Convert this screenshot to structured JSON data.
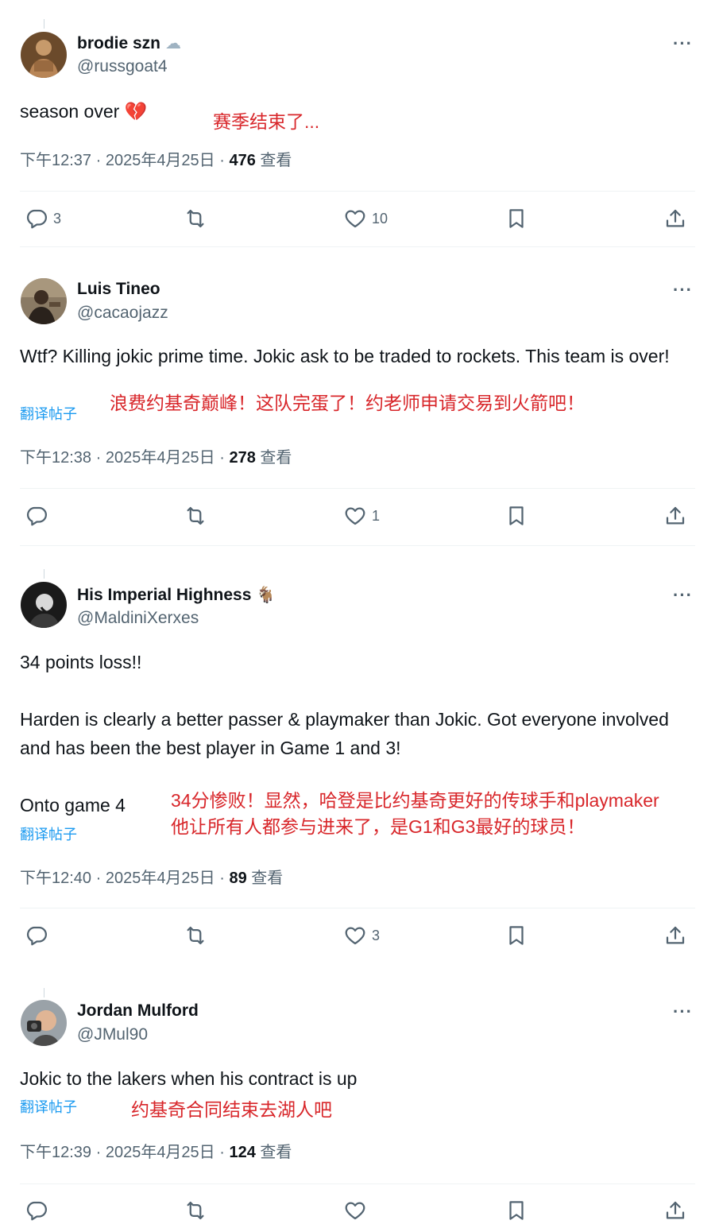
{
  "posts": [
    {
      "display_name": "brodie szn",
      "badge": "☁",
      "handle": "@russgoat4",
      "body": "season over",
      "body_emoji": "💔",
      "translate_label": "",
      "annotation": "赛季结束了...",
      "time": "下午12:37 · 2025年4月25日 · ",
      "views": "476",
      "views_suffix": " 查看",
      "reply_count": "3",
      "retweet_count": "",
      "like_count": "10",
      "more": "···"
    },
    {
      "display_name": "Luis Tineo",
      "handle": "@cacaojazz",
      "body": "Wtf? Killing jokic prime time. Jokic ask to be traded to rockets. This team is over!",
      "translate_label": "翻译帖子",
      "annotation": "浪费约基奇巅峰！这队完蛋了！约老师申请交易到火箭吧！",
      "time": "下午12:38 · 2025年4月25日 · ",
      "views": "278",
      "views_suffix": " 查看",
      "reply_count": "",
      "retweet_count": "",
      "like_count": "1",
      "more": "···"
    },
    {
      "display_name": "His Imperial Highness",
      "badge": "🐐",
      "handle": "@MaldiniXerxes",
      "body_line1": "34 points loss!!",
      "body_line2": "Harden is clearly a better passer & playmaker than Jokic. Got everyone involved and has been the best player in Game 1 and 3!",
      "body_line3": "Onto game 4",
      "translate_label": "翻译帖子",
      "annotation_line1": "34分惨败！显然，哈登是比约基奇更好的传球手和playmaker",
      "annotation_line2": "他让所有人都参与进来了，是G1和G3最好的球员！",
      "time": "下午12:40 · 2025年4月25日 · ",
      "views": "89",
      "views_suffix": " 查看",
      "reply_count": "",
      "retweet_count": "",
      "like_count": "3",
      "more": "···"
    },
    {
      "display_name": "Jordan Mulford",
      "handle": "@JMul90",
      "body": "Jokic to the lakers when his contract is up",
      "translate_label": "翻译帖子",
      "annotation": "约基奇合同结束去湖人吧",
      "time": "下午12:39 · 2025年4月25日 · ",
      "views": "124",
      "views_suffix": " 查看",
      "reply_count": "",
      "retweet_count": "",
      "like_count": "",
      "more": "···"
    }
  ],
  "icons": {
    "reply": "reply-icon",
    "retweet": "retweet-icon",
    "like": "heart-icon",
    "bookmark": "bookmark-icon",
    "share": "share-icon",
    "more": "more-icon"
  },
  "colors": {
    "annotation": "#d8262a",
    "link": "#1d9bf0",
    "muted": "#536471",
    "text": "#0f1419"
  }
}
